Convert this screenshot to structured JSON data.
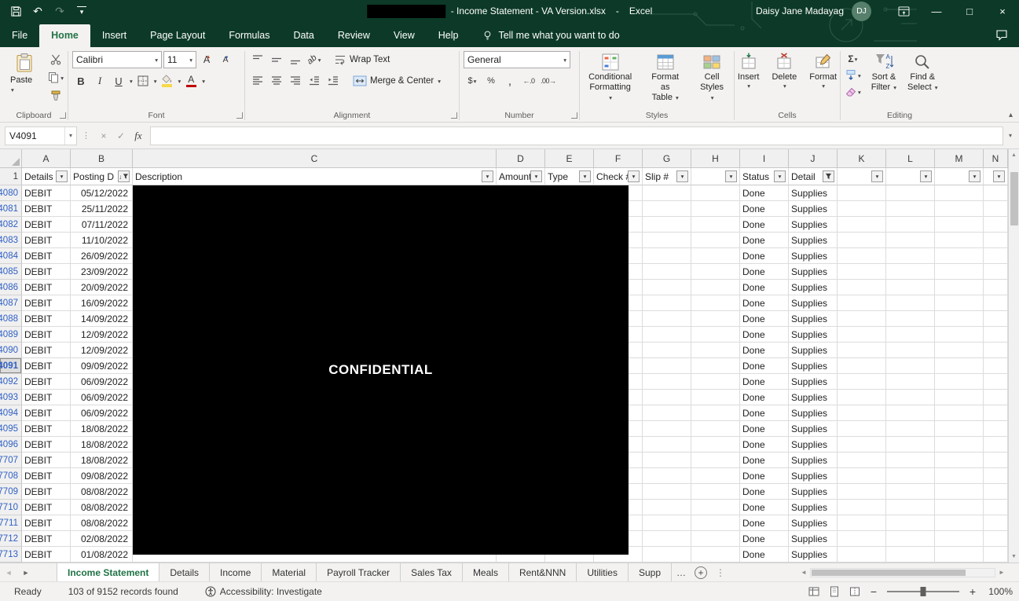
{
  "colors": {
    "accent_green": "#217346",
    "titlebar_green": "#0d3a28",
    "filtered_row_blue": "#2f5fc4",
    "fill_color_swatch": "#f7d84a",
    "font_color_swatch": "#c00000",
    "redaction_black": "#000000"
  },
  "icons": {
    "undo": "↶",
    "redo": "↷",
    "customize_qat": "▾",
    "minimize": "—",
    "maximize": "□",
    "close": "×",
    "dropdown": "▾",
    "autosum": "Σ",
    "accounting": "$",
    "percent": "%",
    "comma": ",",
    "decimal_increase": "←.0",
    "decimal_decrease": ".00→",
    "cancel": "×",
    "enter": "✓",
    "collapse_ribbon": "▴",
    "nav_left": "◄",
    "nav_right": "►",
    "scroll_up": "▲",
    "scroll_down": "▼",
    "splitter": "⋮",
    "more": "…",
    "zoom_out": "−",
    "zoom_in": "+",
    "formula_dots": "⋮"
  },
  "titlebar": {
    "title_doc": "- Income Statement - VA Version.xlsx",
    "title_sep": "-",
    "title_app": "Excel",
    "user_name": "Daisy Jane Madayag",
    "user_initials": "DJ"
  },
  "menu": {
    "tabs": [
      {
        "label": "File",
        "active": false
      },
      {
        "label": "Home",
        "active": true
      },
      {
        "label": "Insert",
        "active": false
      },
      {
        "label": "Page Layout",
        "active": false
      },
      {
        "label": "Formulas",
        "active": false
      },
      {
        "label": "Data",
        "active": false
      },
      {
        "label": "Review",
        "active": false
      },
      {
        "label": "View",
        "active": false
      },
      {
        "label": "Help",
        "active": false
      }
    ],
    "tell_me": "Tell me what you want to do"
  },
  "ribbon": {
    "clipboard": {
      "paste": "Paste",
      "label": "Clipboard"
    },
    "font": {
      "name": "Calibri",
      "size": "11",
      "bold": "B",
      "italic": "I",
      "underline": "U",
      "size_letter": "A",
      "label": "Font"
    },
    "alignment": {
      "wrap_text": "Wrap Text",
      "merge_center": "Merge & Center",
      "orientation": "ab",
      "label": "Alignment"
    },
    "number": {
      "format": "General",
      "label": "Number"
    },
    "styles": {
      "conditional_1": "Conditional",
      "conditional_2": "Formatting",
      "table_1": "Format as",
      "table_2": "Table",
      "cell_1": "Cell",
      "cell_2": "Styles",
      "label": "Styles"
    },
    "cells": {
      "insert": "Insert",
      "delete": "Delete",
      "format": "Format",
      "label": "Cells"
    },
    "editing": {
      "sort_1": "Sort &",
      "sort_2": "Filter",
      "find_1": "Find &",
      "find_2": "Select",
      "label": "Editing"
    }
  },
  "formula_bar": {
    "name_box": "V4091",
    "fx": "fx",
    "formula": ""
  },
  "grid": {
    "columns": [
      "A",
      "B",
      "C",
      "D",
      "E",
      "F",
      "G",
      "H",
      "I",
      "J",
      "K",
      "L",
      "M",
      "N"
    ],
    "filter_headers": {
      "A": "Details",
      "B": "Posting D",
      "C": "Description",
      "D": "Amount",
      "E": "Type",
      "F": "Check #",
      "G": "Slip #",
      "H": "",
      "I": "Status",
      "J": "Detail",
      "K": "",
      "L": "",
      "M": "",
      "N": ""
    },
    "row_filter_number": "1",
    "sorted_column": "B",
    "filtered_columns": [
      "B",
      "J"
    ],
    "active_row": "4091",
    "confidential_text": "CONFIDENTIAL",
    "rows": [
      {
        "n": "4080",
        "details": "DEBIT",
        "date": "05/12/2022",
        "status": "Done",
        "detail": "Supplies"
      },
      {
        "n": "4081",
        "details": "DEBIT",
        "date": "25/11/2022",
        "status": "Done",
        "detail": "Supplies"
      },
      {
        "n": "4082",
        "details": "DEBIT",
        "date": "07/11/2022",
        "status": "Done",
        "detail": "Supplies"
      },
      {
        "n": "4083",
        "details": "DEBIT",
        "date": "11/10/2022",
        "status": "Done",
        "detail": "Supplies"
      },
      {
        "n": "4084",
        "details": "DEBIT",
        "date": "26/09/2022",
        "status": "Done",
        "detail": "Supplies"
      },
      {
        "n": "4085",
        "details": "DEBIT",
        "date": "23/09/2022",
        "status": "Done",
        "detail": "Supplies"
      },
      {
        "n": "4086",
        "details": "DEBIT",
        "date": "20/09/2022",
        "status": "Done",
        "detail": "Supplies"
      },
      {
        "n": "4087",
        "details": "DEBIT",
        "date": "16/09/2022",
        "status": "Done",
        "detail": "Supplies"
      },
      {
        "n": "4088",
        "details": "DEBIT",
        "date": "14/09/2022",
        "status": "Done",
        "detail": "Supplies"
      },
      {
        "n": "4089",
        "details": "DEBIT",
        "date": "12/09/2022",
        "status": "Done",
        "detail": "Supplies"
      },
      {
        "n": "4090",
        "details": "DEBIT",
        "date": "12/09/2022",
        "status": "Done",
        "detail": "Supplies"
      },
      {
        "n": "4091",
        "details": "DEBIT",
        "date": "09/09/2022",
        "status": "Done",
        "detail": "Supplies"
      },
      {
        "n": "4092",
        "details": "DEBIT",
        "date": "06/09/2022",
        "status": "Done",
        "detail": "Supplies"
      },
      {
        "n": "4093",
        "details": "DEBIT",
        "date": "06/09/2022",
        "status": "Done",
        "detail": "Supplies"
      },
      {
        "n": "4094",
        "details": "DEBIT",
        "date": "06/09/2022",
        "status": "Done",
        "detail": "Supplies"
      },
      {
        "n": "4095",
        "details": "DEBIT",
        "date": "18/08/2022",
        "status": "Done",
        "detail": "Supplies"
      },
      {
        "n": "4096",
        "details": "DEBIT",
        "date": "18/08/2022",
        "status": "Done",
        "detail": "Supplies"
      },
      {
        "n": "7707",
        "details": "DEBIT",
        "date": "18/08/2022",
        "status": "Done",
        "detail": "Supplies"
      },
      {
        "n": "7708",
        "details": "DEBIT",
        "date": "09/08/2022",
        "status": "Done",
        "detail": "Supplies"
      },
      {
        "n": "7709",
        "details": "DEBIT",
        "date": "08/08/2022",
        "status": "Done",
        "detail": "Supplies"
      },
      {
        "n": "7710",
        "details": "DEBIT",
        "date": "08/08/2022",
        "status": "Done",
        "detail": "Supplies"
      },
      {
        "n": "7711",
        "details": "DEBIT",
        "date": "08/08/2022",
        "status": "Done",
        "detail": "Supplies"
      },
      {
        "n": "7712",
        "details": "DEBIT",
        "date": "02/08/2022",
        "status": "Done",
        "detail": "Supplies"
      },
      {
        "n": "7713",
        "details": "DEBIT",
        "date": "01/08/2022",
        "status": "Done",
        "detail": "Supplies"
      }
    ]
  },
  "sheet_bar": {
    "tabs": [
      {
        "label": "Income Statement",
        "active": true
      },
      {
        "label": "Details",
        "active": false
      },
      {
        "label": "Income",
        "active": false
      },
      {
        "label": "Material",
        "active": false
      },
      {
        "label": "Payroll Tracker",
        "active": false
      },
      {
        "label": "Sales Tax",
        "active": false
      },
      {
        "label": "Meals",
        "active": false
      },
      {
        "label": "Rent&NNN",
        "active": false
      },
      {
        "label": "Utilities",
        "active": false
      },
      {
        "label": "Supp",
        "active": false
      }
    ],
    "overflow": "…"
  },
  "status_bar": {
    "mode": "Ready",
    "records": "103 of 9152 records found",
    "accessibility": "Accessibility: Investigate",
    "zoom": "100%"
  }
}
